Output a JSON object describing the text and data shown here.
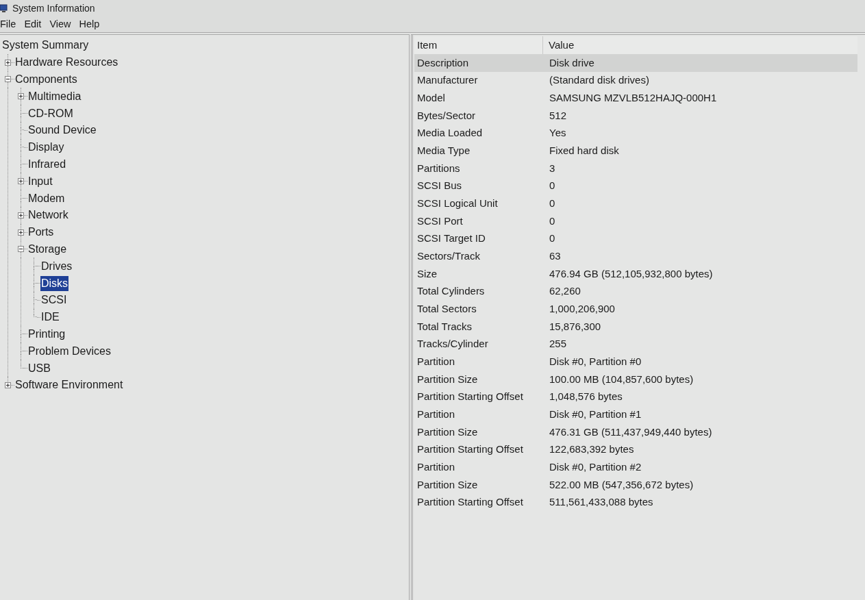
{
  "window": {
    "title": "System Information"
  },
  "menu": [
    "File",
    "Edit",
    "View",
    "Help"
  ],
  "tree": [
    {
      "label": "System Summary",
      "selected": false
    },
    {
      "label": "Hardware Resources",
      "selected": false,
      "expanded": false
    },
    {
      "label": "Components",
      "selected": false,
      "expanded": true,
      "children": [
        {
          "label": "Multimedia",
          "selected": false,
          "expanded": false
        },
        {
          "label": "CD-ROM",
          "selected": false
        },
        {
          "label": "Sound Device",
          "selected": false
        },
        {
          "label": "Display",
          "selected": false
        },
        {
          "label": "Infrared",
          "selected": false
        },
        {
          "label": "Input",
          "selected": false,
          "expanded": false
        },
        {
          "label": "Modem",
          "selected": false
        },
        {
          "label": "Network",
          "selected": false,
          "expanded": false
        },
        {
          "label": "Ports",
          "selected": false,
          "expanded": false
        },
        {
          "label": "Storage",
          "selected": false,
          "expanded": true,
          "children": [
            {
              "label": "Drives",
              "selected": false
            },
            {
              "label": "Disks",
              "selected": true
            },
            {
              "label": "SCSI",
              "selected": false
            },
            {
              "label": "IDE",
              "selected": false
            }
          ]
        },
        {
          "label": "Printing",
          "selected": false
        },
        {
          "label": "Problem Devices",
          "selected": false
        },
        {
          "label": "USB",
          "selected": false
        }
      ]
    },
    {
      "label": "Software Environment",
      "selected": false,
      "expanded": false
    }
  ],
  "table": {
    "columns": [
      "Item",
      "Value"
    ],
    "rows": [
      {
        "item": "Description",
        "value": "Disk drive",
        "selected": true
      },
      {
        "item": "Manufacturer",
        "value": "(Standard disk drives)",
        "selected": false
      },
      {
        "item": "Model",
        "value": "SAMSUNG MZVLB512HAJQ-000H1",
        "selected": false
      },
      {
        "item": "Bytes/Sector",
        "value": "512",
        "selected": false
      },
      {
        "item": "Media Loaded",
        "value": "Yes",
        "selected": false
      },
      {
        "item": "Media Type",
        "value": "Fixed hard disk",
        "selected": false
      },
      {
        "item": "Partitions",
        "value": "3",
        "selected": false
      },
      {
        "item": "SCSI Bus",
        "value": "0",
        "selected": false
      },
      {
        "item": "SCSI Logical Unit",
        "value": "0",
        "selected": false
      },
      {
        "item": "SCSI Port",
        "value": "0",
        "selected": false
      },
      {
        "item": "SCSI Target ID",
        "value": "0",
        "selected": false
      },
      {
        "item": "Sectors/Track",
        "value": "63",
        "selected": false
      },
      {
        "item": "Size",
        "value": "476.94 GB (512,105,932,800 bytes)",
        "selected": false
      },
      {
        "item": "Total Cylinders",
        "value": "62,260",
        "selected": false
      },
      {
        "item": "Total Sectors",
        "value": "1,000,206,900",
        "selected": false
      },
      {
        "item": "Total Tracks",
        "value": "15,876,300",
        "selected": false
      },
      {
        "item": "Tracks/Cylinder",
        "value": "255",
        "selected": false
      },
      {
        "item": "Partition",
        "value": "Disk #0, Partition #0",
        "selected": false
      },
      {
        "item": "Partition Size",
        "value": "100.00 MB (104,857,600 bytes)",
        "selected": false
      },
      {
        "item": "Partition Starting Offset",
        "value": "1,048,576 bytes",
        "selected": false
      },
      {
        "item": "Partition",
        "value": "Disk #0, Partition #1",
        "selected": false
      },
      {
        "item": "Partition Size",
        "value": "476.31 GB (511,437,949,440 bytes)",
        "selected": false
      },
      {
        "item": "Partition Starting Offset",
        "value": "122,683,392 bytes",
        "selected": false
      },
      {
        "item": "Partition",
        "value": "Disk #0, Partition #2",
        "selected": false
      },
      {
        "item": "Partition Size",
        "value": "522.00 MB (547,356,672 bytes)",
        "selected": false
      },
      {
        "item": "Partition Starting Offset",
        "value": "511,561,433,088 bytes",
        "selected": false
      }
    ]
  }
}
